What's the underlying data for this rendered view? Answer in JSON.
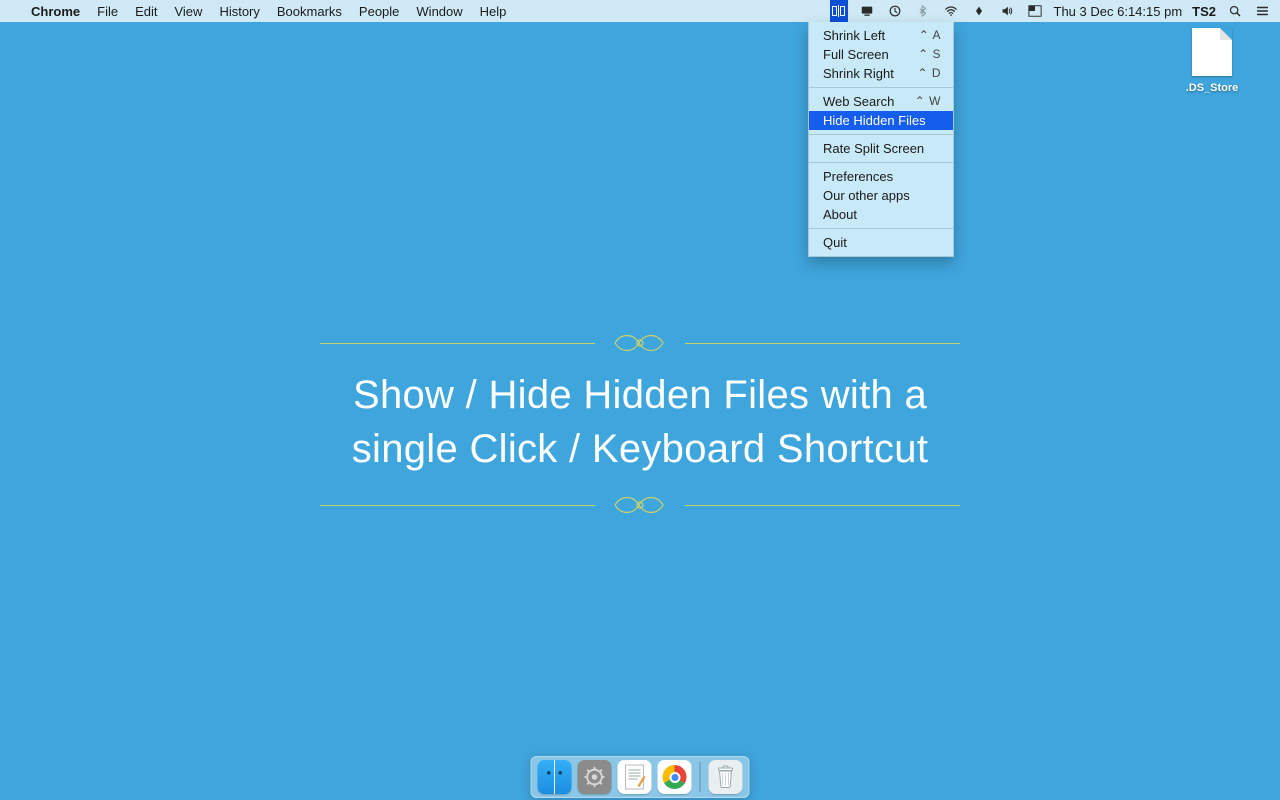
{
  "menubar": {
    "app": "Chrome",
    "items": [
      "File",
      "Edit",
      "View",
      "History",
      "Bookmarks",
      "People",
      "Window",
      "Help"
    ],
    "clock": "Thu 3 Dec  6:14:15 pm",
    "user": "TS2"
  },
  "dropdown": {
    "section1": [
      {
        "label": "Shrink Left",
        "shortcut": "⌃ A"
      },
      {
        "label": "Full Screen",
        "shortcut": "⌃ S"
      },
      {
        "label": "Shrink Right",
        "shortcut": "⌃ D"
      }
    ],
    "section2": [
      {
        "label": "Web Search",
        "shortcut": "⌃ W"
      },
      {
        "label": "Hide Hidden Files",
        "shortcut": "",
        "selected": true
      }
    ],
    "section3": [
      {
        "label": "Rate Split Screen",
        "shortcut": ""
      }
    ],
    "section4": [
      {
        "label": "Preferences",
        "shortcut": ""
      },
      {
        "label": "Our other apps",
        "shortcut": ""
      },
      {
        "label": "About",
        "shortcut": ""
      }
    ],
    "section5": [
      {
        "label": "Quit",
        "shortcut": ""
      }
    ]
  },
  "desktop": {
    "file_label": ".DS_Store"
  },
  "hero": {
    "title": "Show / Hide Hidden Files with a single Click / Keyboard Shortcut"
  },
  "dock": {
    "items": [
      "finder",
      "system-preferences",
      "textedit",
      "chrome"
    ],
    "trash": "trash"
  }
}
